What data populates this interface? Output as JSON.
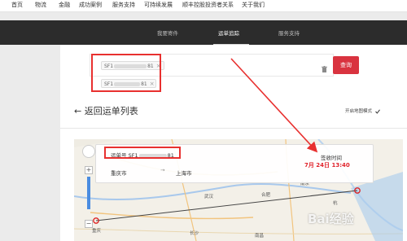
{
  "top_nav": [
    "首页",
    "物流",
    "金融",
    "成功案例",
    "服务支持",
    "可持续发展",
    "顺丰控股投资者关系",
    "关于我们"
  ],
  "sub_nav": {
    "tabs": [
      "我要寄件",
      "运单追踪",
      "服务支持"
    ],
    "active": "运单追踪"
  },
  "waybill_input": {
    "chips": [
      {
        "prefix": "SF1",
        "suffix": "81",
        "close": "×"
      },
      {
        "prefix": "SF1",
        "suffix": "81",
        "close": "×"
      }
    ],
    "query_button": "查询"
  },
  "back_link": "返回运单列表",
  "map_mode_label": "开启地图模式",
  "map_mode_checked": true,
  "waybill_card": {
    "label": "运单号",
    "number_prefix": "SF1",
    "number_suffix": "81",
    "from_city": "重庆市",
    "to_city": "上海市",
    "sign_label": "签收时间",
    "sign_time": "7月 24日 13:40"
  },
  "map": {
    "labels": [
      "武汉",
      "南京",
      "杭",
      "合肥",
      "重庆",
      "长沙",
      "南昌"
    ],
    "zoom_in": "+",
    "zoom_out": "−"
  },
  "watermark": "Bai经验",
  "colors": {
    "accent_red": "#d9333f",
    "annotation_red": "#e8302f",
    "nav_dark": "#2c2c2c"
  }
}
